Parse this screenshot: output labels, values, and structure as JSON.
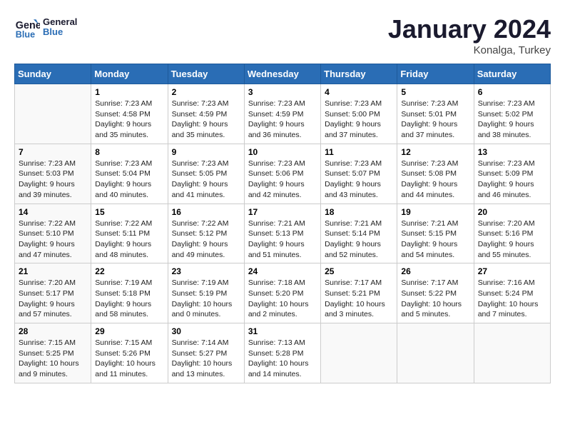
{
  "header": {
    "logo_line1": "General",
    "logo_line2": "Blue",
    "month": "January 2024",
    "location": "Konalga, Turkey"
  },
  "days_of_week": [
    "Sunday",
    "Monday",
    "Tuesday",
    "Wednesday",
    "Thursday",
    "Friday",
    "Saturday"
  ],
  "weeks": [
    [
      {
        "day": "",
        "sunrise": "",
        "sunset": "",
        "daylight": ""
      },
      {
        "day": "1",
        "sunrise": "Sunrise: 7:23 AM",
        "sunset": "Sunset: 4:58 PM",
        "daylight": "Daylight: 9 hours and 35 minutes."
      },
      {
        "day": "2",
        "sunrise": "Sunrise: 7:23 AM",
        "sunset": "Sunset: 4:59 PM",
        "daylight": "Daylight: 9 hours and 35 minutes."
      },
      {
        "day": "3",
        "sunrise": "Sunrise: 7:23 AM",
        "sunset": "Sunset: 4:59 PM",
        "daylight": "Daylight: 9 hours and 36 minutes."
      },
      {
        "day": "4",
        "sunrise": "Sunrise: 7:23 AM",
        "sunset": "Sunset: 5:00 PM",
        "daylight": "Daylight: 9 hours and 37 minutes."
      },
      {
        "day": "5",
        "sunrise": "Sunrise: 7:23 AM",
        "sunset": "Sunset: 5:01 PM",
        "daylight": "Daylight: 9 hours and 37 minutes."
      },
      {
        "day": "6",
        "sunrise": "Sunrise: 7:23 AM",
        "sunset": "Sunset: 5:02 PM",
        "daylight": "Daylight: 9 hours and 38 minutes."
      }
    ],
    [
      {
        "day": "7",
        "sunrise": "Sunrise: 7:23 AM",
        "sunset": "Sunset: 5:03 PM",
        "daylight": "Daylight: 9 hours and 39 minutes."
      },
      {
        "day": "8",
        "sunrise": "Sunrise: 7:23 AM",
        "sunset": "Sunset: 5:04 PM",
        "daylight": "Daylight: 9 hours and 40 minutes."
      },
      {
        "day": "9",
        "sunrise": "Sunrise: 7:23 AM",
        "sunset": "Sunset: 5:05 PM",
        "daylight": "Daylight: 9 hours and 41 minutes."
      },
      {
        "day": "10",
        "sunrise": "Sunrise: 7:23 AM",
        "sunset": "Sunset: 5:06 PM",
        "daylight": "Daylight: 9 hours and 42 minutes."
      },
      {
        "day": "11",
        "sunrise": "Sunrise: 7:23 AM",
        "sunset": "Sunset: 5:07 PM",
        "daylight": "Daylight: 9 hours and 43 minutes."
      },
      {
        "day": "12",
        "sunrise": "Sunrise: 7:23 AM",
        "sunset": "Sunset: 5:08 PM",
        "daylight": "Daylight: 9 hours and 44 minutes."
      },
      {
        "day": "13",
        "sunrise": "Sunrise: 7:23 AM",
        "sunset": "Sunset: 5:09 PM",
        "daylight": "Daylight: 9 hours and 46 minutes."
      }
    ],
    [
      {
        "day": "14",
        "sunrise": "Sunrise: 7:22 AM",
        "sunset": "Sunset: 5:10 PM",
        "daylight": "Daylight: 9 hours and 47 minutes."
      },
      {
        "day": "15",
        "sunrise": "Sunrise: 7:22 AM",
        "sunset": "Sunset: 5:11 PM",
        "daylight": "Daylight: 9 hours and 48 minutes."
      },
      {
        "day": "16",
        "sunrise": "Sunrise: 7:22 AM",
        "sunset": "Sunset: 5:12 PM",
        "daylight": "Daylight: 9 hours and 49 minutes."
      },
      {
        "day": "17",
        "sunrise": "Sunrise: 7:21 AM",
        "sunset": "Sunset: 5:13 PM",
        "daylight": "Daylight: 9 hours and 51 minutes."
      },
      {
        "day": "18",
        "sunrise": "Sunrise: 7:21 AM",
        "sunset": "Sunset: 5:14 PM",
        "daylight": "Daylight: 9 hours and 52 minutes."
      },
      {
        "day": "19",
        "sunrise": "Sunrise: 7:21 AM",
        "sunset": "Sunset: 5:15 PM",
        "daylight": "Daylight: 9 hours and 54 minutes."
      },
      {
        "day": "20",
        "sunrise": "Sunrise: 7:20 AM",
        "sunset": "Sunset: 5:16 PM",
        "daylight": "Daylight: 9 hours and 55 minutes."
      }
    ],
    [
      {
        "day": "21",
        "sunrise": "Sunrise: 7:20 AM",
        "sunset": "Sunset: 5:17 PM",
        "daylight": "Daylight: 9 hours and 57 minutes."
      },
      {
        "day": "22",
        "sunrise": "Sunrise: 7:19 AM",
        "sunset": "Sunset: 5:18 PM",
        "daylight": "Daylight: 9 hours and 58 minutes."
      },
      {
        "day": "23",
        "sunrise": "Sunrise: 7:19 AM",
        "sunset": "Sunset: 5:19 PM",
        "daylight": "Daylight: 10 hours and 0 minutes."
      },
      {
        "day": "24",
        "sunrise": "Sunrise: 7:18 AM",
        "sunset": "Sunset: 5:20 PM",
        "daylight": "Daylight: 10 hours and 2 minutes."
      },
      {
        "day": "25",
        "sunrise": "Sunrise: 7:17 AM",
        "sunset": "Sunset: 5:21 PM",
        "daylight": "Daylight: 10 hours and 3 minutes."
      },
      {
        "day": "26",
        "sunrise": "Sunrise: 7:17 AM",
        "sunset": "Sunset: 5:22 PM",
        "daylight": "Daylight: 10 hours and 5 minutes."
      },
      {
        "day": "27",
        "sunrise": "Sunrise: 7:16 AM",
        "sunset": "Sunset: 5:24 PM",
        "daylight": "Daylight: 10 hours and 7 minutes."
      }
    ],
    [
      {
        "day": "28",
        "sunrise": "Sunrise: 7:15 AM",
        "sunset": "Sunset: 5:25 PM",
        "daylight": "Daylight: 10 hours and 9 minutes."
      },
      {
        "day": "29",
        "sunrise": "Sunrise: 7:15 AM",
        "sunset": "Sunset: 5:26 PM",
        "daylight": "Daylight: 10 hours and 11 minutes."
      },
      {
        "day": "30",
        "sunrise": "Sunrise: 7:14 AM",
        "sunset": "Sunset: 5:27 PM",
        "daylight": "Daylight: 10 hours and 13 minutes."
      },
      {
        "day": "31",
        "sunrise": "Sunrise: 7:13 AM",
        "sunset": "Sunset: 5:28 PM",
        "daylight": "Daylight: 10 hours and 14 minutes."
      },
      {
        "day": "",
        "sunrise": "",
        "sunset": "",
        "daylight": ""
      },
      {
        "day": "",
        "sunrise": "",
        "sunset": "",
        "daylight": ""
      },
      {
        "day": "",
        "sunrise": "",
        "sunset": "",
        "daylight": ""
      }
    ]
  ]
}
